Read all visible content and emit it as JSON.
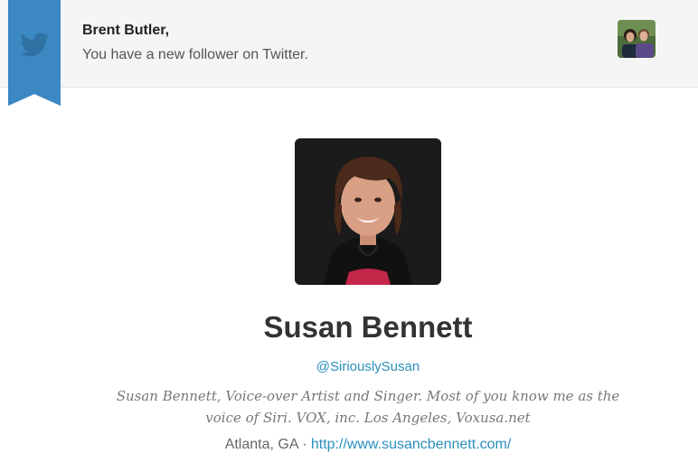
{
  "notification": {
    "greeting": "Brent Butler,",
    "message": "You have a new follower on Twitter.",
    "icon": "twitter-bird-icon",
    "accent_color": "#3b88c3"
  },
  "profile": {
    "name": "Susan Bennett",
    "handle": "@SiriouslySusan",
    "bio": "Susan Bennett, Voice-over Artist and Singer. Most of you know me as the voice of Siri. VOX, inc. Los Angeles, Voxusa.net",
    "location": "Atlanta, GA",
    "separator": "·",
    "website": "http://www.susancbennett.com/"
  },
  "colors": {
    "link": "#2a8fbd",
    "name_text": "#333333",
    "header_bg": "#f5f5f5"
  }
}
